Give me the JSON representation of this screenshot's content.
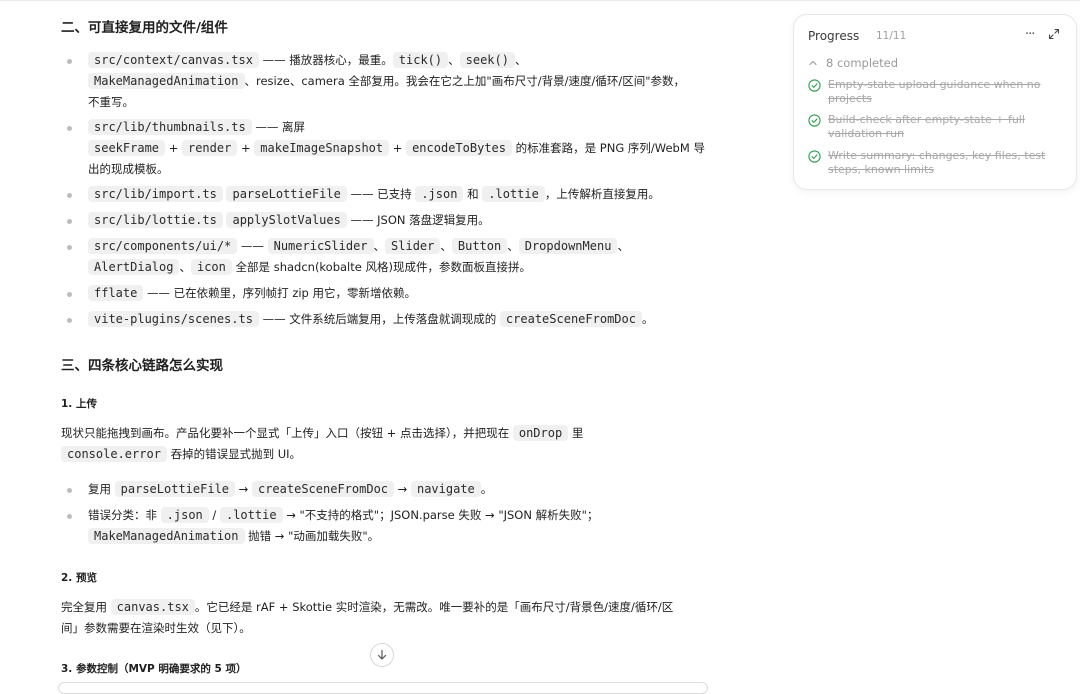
{
  "section2": {
    "heading": "二、可直接复用的文件/组件",
    "b1": {
      "code1": "src/context/canvas.tsx",
      "t1": " —— 播放器核心，最重。",
      "code2": "tick()",
      "t2": "、",
      "code3": "seek()",
      "t3": "、",
      "code4": "MakeManagedAnimation",
      "t4": "、resize、camera 全部复用。我会在它之上加\"画布尺寸/背景/速度/循环/区间\"参数，",
      "t5": "不重写。"
    },
    "b2": {
      "code1": "src/lib/thumbnails.ts",
      "t1": " —— 离屏",
      "code2": "seekFrame",
      "t2": "+",
      "code3": "render",
      "t3": "+",
      "code4": "makeImageSnapshot",
      "t4": "+",
      "code5": "encodeToBytes",
      "t5": " 的标准套路，是 PNG 序列/WebM 导",
      "t6": "出的现成模板。"
    },
    "b3": {
      "code1": "src/lib/import.ts",
      "code2": "parseLottieFile",
      "t1": " —— 已支持 ",
      "code3": ".json",
      "t2": " 和 ",
      "code4": ".lottie",
      "t3": "，上传解析直接复用。"
    },
    "b4": {
      "code1": "src/lib/lottie.ts",
      "code2": "applySlotValues",
      "t1": " —— JSON 落盘逻辑复用。"
    },
    "b5": {
      "code1": "src/components/ui/*",
      "t1": " —— ",
      "code2": "NumericSlider",
      "t2": "、",
      "code3": "Slider",
      "t3": "、",
      "code4": "Button",
      "t4": "、",
      "code5": "DropdownMenu",
      "t5": "、",
      "code6": "AlertDialog",
      "t6": "、",
      "code7": "icon",
      "t7": " 全部是 shadcn(kobalte 风格)现成件，参数面板直接拼。"
    },
    "b6": {
      "code1": "fflate",
      "t1": " —— 已在依赖里，序列帧打 zip 用它，零新增依赖。"
    },
    "b7": {
      "code1": "vite-plugins/scenes.ts",
      "t1": " —— 文件系统后端复用，上传落盘就调现成的 ",
      "code2": "createSceneFromDoc",
      "t2": "。"
    }
  },
  "section3": {
    "heading": "三、四条核心链路怎么实现",
    "sub1": {
      "heading": "1. 上传",
      "p_t1": "现状只能拖拽到画布。产品化要补一个显式「上传」入口（按钮 + 点击选择），并把现在 ",
      "p_code1": "onDrop",
      "p_t2": " 里",
      "p_code2": "console.error",
      "p_t3": " 吞掉的错误显式抛到 UI。",
      "b1": {
        "t1": "复用 ",
        "code1": "parseLottieFile",
        "t2": " → ",
        "code2": "createSceneFromDoc",
        "t3": " → ",
        "code3": "navigate",
        "t4": "。"
      },
      "b2": {
        "t1": "错误分类：非 ",
        "code1": ".json",
        "t2": " / ",
        "code2": ".lottie",
        "t3": " → \"不支持的格式\"；JSON.parse 失败 → \"JSON 解析失败\"；",
        "code3": "MakeManagedAnimation",
        "t4": " 抛错 → \"动画加载失败\"。"
      }
    },
    "sub2": {
      "heading": "2. 预览",
      "p_t1": "完全复用 ",
      "p_code1": "canvas.tsx",
      "p_t2": "。它已经是 rAF + Skottie 实时渲染，无需改。唯一要补的是「画布尺寸/背景色/速度/循环/区",
      "p_t3": "间」参数需要在渲染时生效（见下）。"
    },
    "sub3": {
      "heading": "3. 参数控制（MVP 明确要求的 5 项）"
    }
  },
  "progress": {
    "title": "Progress",
    "count": "11/11",
    "more": "···",
    "summary": "8 completed",
    "items": [
      "Empty-state upload guidance when no projects",
      "Build-check after empty-state + full validation run",
      "Write summary: changes, key files, test steps, known limits"
    ],
    "check_color": "#2e9e4f"
  }
}
